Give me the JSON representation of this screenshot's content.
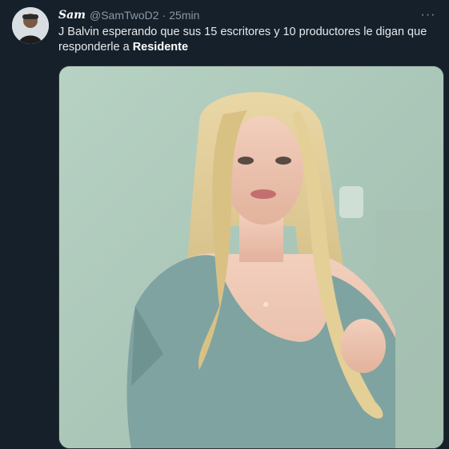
{
  "tweet": {
    "author_name": "Sam",
    "author_handle": "@SamTwoD2",
    "separator": "·",
    "time": "25min",
    "more_label": "···",
    "text_prefix": "J Balvin esperando que sus 15 escritores y 10 productores le digan que responderle a ",
    "text_bold": "Residente"
  },
  "media": {
    "description_icon": "photo-of-crying-blonde-woman"
  },
  "colors": {
    "background": "#15202b",
    "secondary_text": "#8b98a5",
    "primary_text": "#e7e9ea"
  }
}
